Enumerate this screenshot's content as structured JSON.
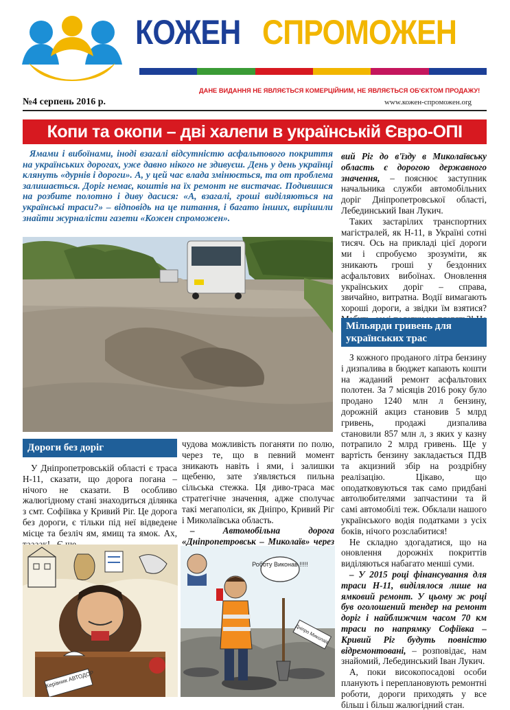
{
  "masthead": {
    "title_word1": "КОЖЕН",
    "title_word2": "СПРОМОЖЕН",
    "stripe_colors": [
      "#1c3f97",
      "#3a9b35",
      "#d71920",
      "#f2b600",
      "#c4165d",
      "#1c3f97"
    ],
    "brand_blue": "#1c3f97",
    "brand_yellow": "#f2b600",
    "disclaimer": "ДАНЕ ВИДАННЯ НЕ ЯВЛЯЄТЬСЯ КОМЕРЦІЙНИМ, НЕ ЯВЛЯЄТЬСЯ ОБ'ЄКТОМ ПРОДАЖУ!",
    "issue": "№4   серпень  2016 р.",
    "website": "www.кожен-спроможен.org"
  },
  "headline": "Копи та окопи – дві халепи в українській Євро-ОПІ",
  "lead": "Ямами і вибоїнами, іноді взагалі відсутністю асфальтового покриття на українських дорогах, уже давно нікого не здивуєш. День у день українці клянуть «дурнів і дороги». А, у цей час влада змінюється, та от проблема залишається. Доріг немає, коштів на їх ремонт не вистачає. Подивишся на розбите полотно і диву дасися: «А, взагалі, гроші виділяються на українські траси?» – відповідь на це питання, і багато інших, вирішили знайти журналісти газети «Кожен спроможен».",
  "sections": {
    "left_heading": "Дороги без доріг",
    "left_p1": "У Дніпропетровській області є траса Н-11, сказати, що дорога погана – нічого не сказати. В особливо жалюгідному стані знаходиться ділянка з смт. Софіївка у Кривий Ріг. Це дорога без дороги, є тільки під неї відведене місце та безліч ям, ямищ та ямок. Ах, таааак!.. Є ще",
    "mid_p1": "чудова можливість поганяти по полю, через те, що в певний момент зникають навіть і ями, і залишки щебеню, зате з'являється пильна сільська стежка. Ця диво-траса має стратегічне значення, адже сполучає такі мегаполіси, як Дніпро, Кривий Ріг і Миколаївська область.",
    "mid_p2": "– Автомобільна дорога «Дніпропетровськ – Миколаїв» через Кри-",
    "right_p1_em": "вий Ріг до в'їзду в Миколаївську область є дорогою державного значення,",
    "right_p1_rest": " – пояснює заступник начальника служби автомобільних доріг Дніпропетровської області, Лебединський Іван Лукич.",
    "right_p2": "Таких застарілих транспортних магістралей, як Н-11, в Україні сотні тисяч. Ось на прикладі цієї дороги ми і спробуємо зрозуміти, як зникають гроші у бездонних асфальтових вибоїнах. Оновлення українських доріг – справа, звичайно, витратна. Водії вимагають хороші дороги, а звідки їм взятися? Мабуть, самі податки не платять?! Не тут-то було!",
    "right_heading": "Мільярди гривень для українських трас",
    "right_p3": "З кожного проданого літра бензину і дизпалива в бюджет капають кошти на жаданий ремонт асфальтових полотен. За 7 місяців 2016 року було продано 1240 млн л бензину, дорожній акциз становив 5 млрд гривень, продажі дизпалива становили 857 млн л, з яких у казну потрапило 2 млрд гривень. Ще у вартість бензину закладається ПДВ та акцизний збір на роздрібну реалізацію. Цікаво, що оподатковуються так само придбані автолюбителями запчастини та й самі автомобілі теж. Обклали нашого українського водія податками з усіх боків, нічого розслабитися!",
    "right_p4": "Не складно здогадатися, що на оновлення дорожніх покриттів виділяються набагато менші суми.",
    "right_p5_em": "– У 2015 році фінансування для траси Н-11, виділялося лише на ямковий ремонт. У цьому ж році був оголошений тендер на ремонт доріг і найближчим часом 70 км траси по напрямку Софіївка – Кривий Ріг будуть повністю відремонтовані,",
    "right_p5_rest": " – розповідає, нам знайомий, Лебединський Іван Лукич.",
    "right_p6": "А, поки високопосадові особи планують і переплановують ремонтні роботи, дороги приходять у все більш і більш жалюгідний стан."
  },
  "cartoons": {
    "left_sign": "Керівник АВТОДОР",
    "right_bubble": "Роботу Виконав !!!!!",
    "right_sign": "Дніпро Миколаїв"
  },
  "colors": {
    "headline_red": "#d71920",
    "section_blue": "#1f5f99"
  }
}
